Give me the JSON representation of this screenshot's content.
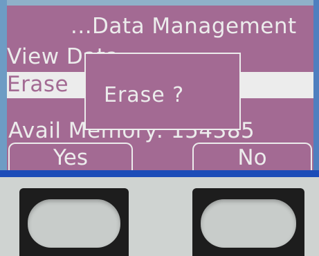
{
  "screen": {
    "title": "...Data Management",
    "menu": {
      "view_label": "View Data",
      "erase_label": "Erase"
    },
    "avail_memory": "Avail Memory:  154385"
  },
  "dialog": {
    "message": "Erase ?"
  },
  "softkeys": {
    "yes_label": "Yes",
    "no_label": "No"
  },
  "colors": {
    "lcd_background": "#a36a93",
    "lcd_text": "#ececec",
    "bezel": "#1c4cb8",
    "hardware_button_housing": "#1d1d1d",
    "panel": "#cfd3d1"
  }
}
